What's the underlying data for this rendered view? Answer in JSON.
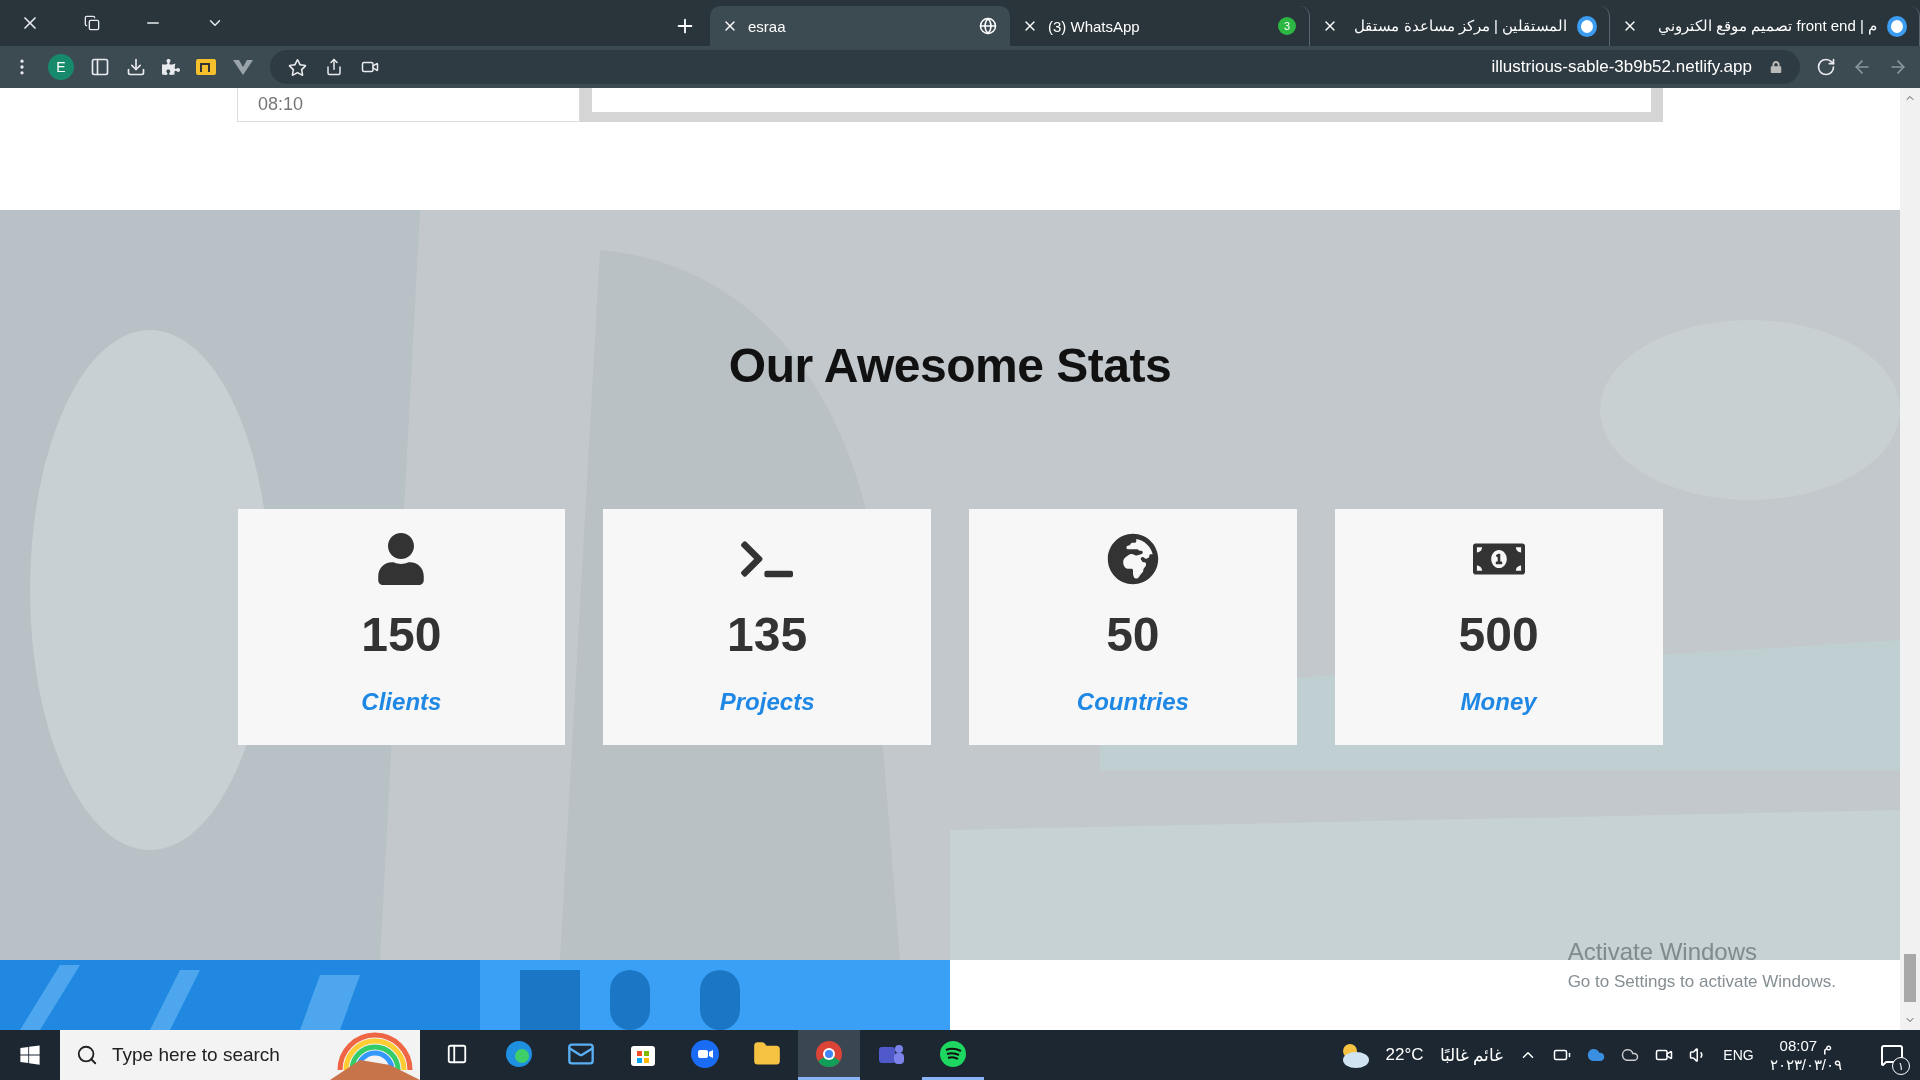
{
  "browser": {
    "tabs": [
      {
        "title": "esraa",
        "selected": true
      },
      {
        "title": "(3) WhatsApp",
        "selected": false,
        "favicon_badge": "3"
      },
      {
        "title": "المستقلين | مركز مساعدة مستقل",
        "selected": false
      },
      {
        "title": "تصميم موقع الكتروني front end | م",
        "selected": false
      }
    ],
    "address": "illustrious-sable-3b9b52.netlify.app",
    "profile": "E"
  },
  "page": {
    "previous_section": {
      "time": "08:10"
    },
    "stats": {
      "title": "Our Awesome Stats",
      "items": [
        {
          "number": "150",
          "label": "Clients"
        },
        {
          "number": "135",
          "label": "Projects"
        },
        {
          "number": "50",
          "label": "Countries"
        },
        {
          "number": "500",
          "label": "Money"
        }
      ]
    }
  },
  "activation": {
    "title": "Activate Windows",
    "subtitle": "Go to Settings to activate Windows."
  },
  "taskbar": {
    "search_placeholder": "Type here to search",
    "weather": {
      "temperature": "22°C",
      "condition": "غائم غالبًا"
    },
    "language": "ENG",
    "time": "08:07",
    "period": "م",
    "date": "٢٠٢٣/٠٣/٠٩",
    "notifications": "١"
  }
}
